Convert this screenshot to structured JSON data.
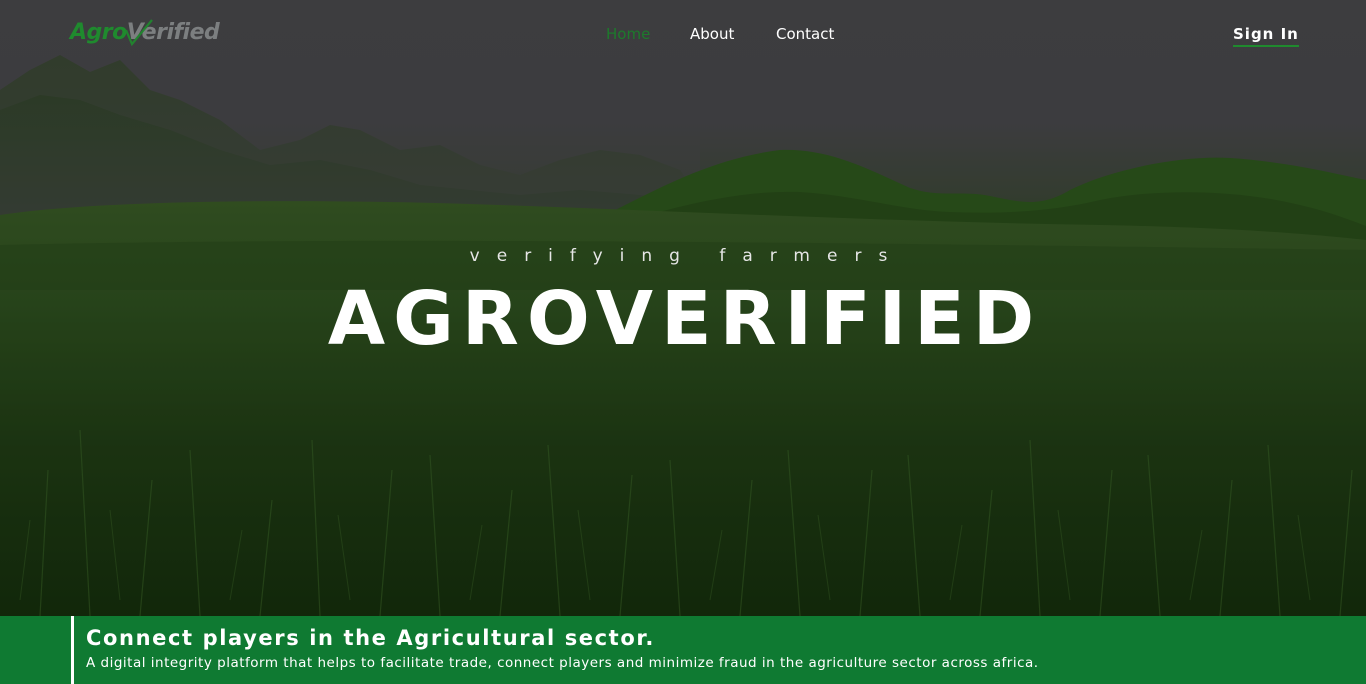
{
  "brand": {
    "logo_part1": "Agro",
    "logo_part2": "Verified",
    "accent_color": "#1f8a2e",
    "logo_gray": "#7c7f80"
  },
  "nav": {
    "items": [
      {
        "label": "Home",
        "active": true
      },
      {
        "label": "About",
        "active": false
      },
      {
        "label": "Contact",
        "active": false
      }
    ],
    "sign_in_label": "Sign In"
  },
  "hero": {
    "tagline": "verifying farmers",
    "headline": "AGROVERIFIED"
  },
  "banner": {
    "title": "Connect players in the Agricultural sector.",
    "text": "A digital integrity platform that helps to facilitate trade, connect players and minimize fraud in the agriculture sector across africa.",
    "background_color": "#0f7a32"
  }
}
